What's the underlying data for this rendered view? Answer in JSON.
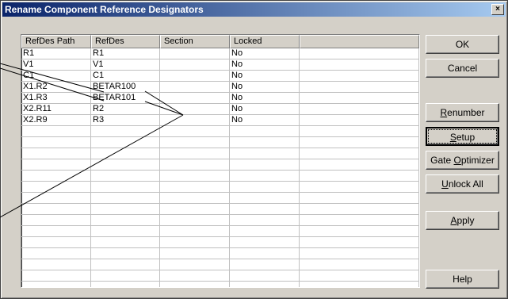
{
  "window": {
    "title": "Rename Component Reference Designators",
    "close_glyph": "×"
  },
  "grid": {
    "columns": [
      "RefDes Path",
      "RefDes",
      "Section",
      "Locked",
      ""
    ],
    "rows": [
      [
        "R1",
        "R1",
        "",
        "No",
        ""
      ],
      [
        "V1",
        "V1",
        "",
        "No",
        ""
      ],
      [
        "C1",
        "C1",
        "",
        "No",
        ""
      ],
      [
        "X1.R2",
        "BETAR100",
        "",
        "No",
        ""
      ],
      [
        "X1.R3",
        "BETAR101",
        "",
        "No",
        ""
      ],
      [
        "X2.R11",
        "R2",
        "",
        "No",
        ""
      ],
      [
        "X2.R9",
        "R3",
        "",
        "No",
        ""
      ],
      [
        "",
        "",
        "",
        "",
        ""
      ],
      [
        "",
        "",
        "",
        "",
        ""
      ],
      [
        "",
        "",
        "",
        "",
        ""
      ],
      [
        "",
        "",
        "",
        "",
        ""
      ],
      [
        "",
        "",
        "",
        "",
        ""
      ],
      [
        "",
        "",
        "",
        "",
        ""
      ],
      [
        "",
        "",
        "",
        "",
        ""
      ],
      [
        "",
        "",
        "",
        "",
        ""
      ],
      [
        "",
        "",
        "",
        "",
        ""
      ],
      [
        "",
        "",
        "",
        "",
        ""
      ],
      [
        "",
        "",
        "",
        "",
        ""
      ],
      [
        "",
        "",
        "",
        "",
        ""
      ],
      [
        "",
        "",
        "",
        "",
        ""
      ],
      [
        "",
        "",
        "",
        "",
        ""
      ],
      [
        "",
        "",
        "",
        "",
        ""
      ]
    ]
  },
  "buttons": {
    "ok": "OK",
    "cancel": "Cancel",
    "renumber": {
      "accel": "R",
      "rest": "enumber"
    },
    "setup": {
      "accel": "S",
      "rest": "etup"
    },
    "gate_optimizer": {
      "pre": "Gate ",
      "accel": "O",
      "rest": "ptimizer"
    },
    "unlock_all": {
      "accel": "U",
      "rest": "nlock All"
    },
    "apply": {
      "accel": "A",
      "rest": "pply"
    },
    "help": "Help"
  },
  "colors": {
    "title_start": "#0a246a",
    "title_end": "#a6caf0",
    "face": "#d4d0c8",
    "annotation_lines": "#000000"
  }
}
